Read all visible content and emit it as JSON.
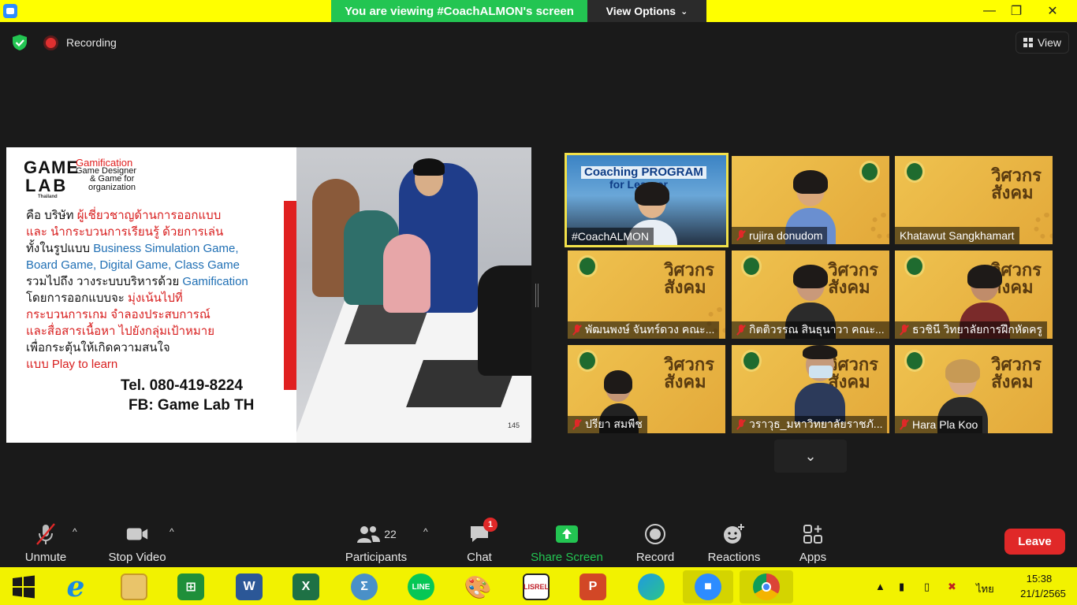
{
  "window": {
    "banner_text": "You are viewing #CoachALMON's screen",
    "view_options_label": "View Options",
    "minimize_glyph": "—",
    "maximize_glyph": "❐",
    "close_glyph": "✕"
  },
  "status": {
    "recording_label": "Recording",
    "view_label": "View"
  },
  "slide": {
    "logo_game": "GAME",
    "logo_lab": "LAB",
    "logo_thailand": "Thailand",
    "logo_gamification": "Gamification",
    "logo_sub1": "Game Designer",
    "logo_sub2": "& Game for",
    "logo_sub3": "organization",
    "lines": [
      {
        "parts": [
          "คือ บริษัท ",
          "ผู้เชี่ยวชาญด้านการออกแบบ"
        ]
      },
      {
        "parts": [
          "และ นำกระบวนการเรียนรู้ ด้วยการเล่น"
        ]
      },
      {
        "parts": [
          "ทั้งในรูปแบบ ",
          "Business Simulation Game,"
        ]
      },
      {
        "parts": [
          "Board Game, Digital Game, Class Game"
        ]
      },
      {
        "parts": [
          "รวมไปถึง วางระบบบริหารด้วย ",
          "Gamification"
        ]
      },
      {
        "parts": [
          "โดยการออกแบบจะ ",
          "มุ่งเน้นไปที่"
        ]
      },
      {
        "parts": [
          "กระบวนการเกม จำลองประสบการณ์"
        ]
      },
      {
        "parts": [
          "และสื่อสารเนื้อหา ไปยังกลุ่มเป้าหมาย"
        ]
      },
      {
        "parts": [
          "เพื่อกระตุ้นให้เกิดความสนใจ"
        ]
      },
      {
        "parts": [
          "แบบ Play to learn"
        ]
      }
    ],
    "tel": "Tel. 080-419-8224",
    "fb": "FB: Game Lab TH",
    "page_number": "145"
  },
  "participants": [
    {
      "name": "#CoachALMON",
      "muted": false,
      "banner1": "Coaching PROGRAM",
      "banner2": "for Learner"
    },
    {
      "name": "rujira donudom",
      "muted": true
    },
    {
      "name": "Khatawut Sangkhamart",
      "muted": false
    },
    {
      "name": "พัฒนพงษ์ จันทร์ดวง คณะ...",
      "muted": true
    },
    {
      "name": "กิตติวรรณ สินธุนาวา คณะ...",
      "muted": true
    },
    {
      "name": "ธวชินี  วิทยาลัยการฝึกหัดครู",
      "muted": true
    },
    {
      "name": "ปรียา สมพืช",
      "muted": true
    },
    {
      "name": "วราวุธ_มหาวิทยาลัยราชภั...",
      "muted": true
    },
    {
      "name": "Hara Pla Koo",
      "muted": true
    }
  ],
  "tile_title": "วิศวกร\nสังคม",
  "toolbar": {
    "unmute": "Unmute",
    "stop_video": "Stop Video",
    "participants": "Participants",
    "participants_count": "22",
    "chat": "Chat",
    "chat_badge": "1",
    "share_screen": "Share Screen",
    "record": "Record",
    "reactions": "Reactions",
    "apps": "Apps",
    "leave": "Leave"
  },
  "taskbar": {
    "language": "ไทย",
    "time": "15:38",
    "date": "21/1/2565"
  },
  "colors": {
    "accent_green": "#23c552",
    "leave_red": "#e02828",
    "highlight_yellow": "#ffff00",
    "slide_red": "#d81e1e",
    "slide_blue": "#1f6fb4"
  }
}
